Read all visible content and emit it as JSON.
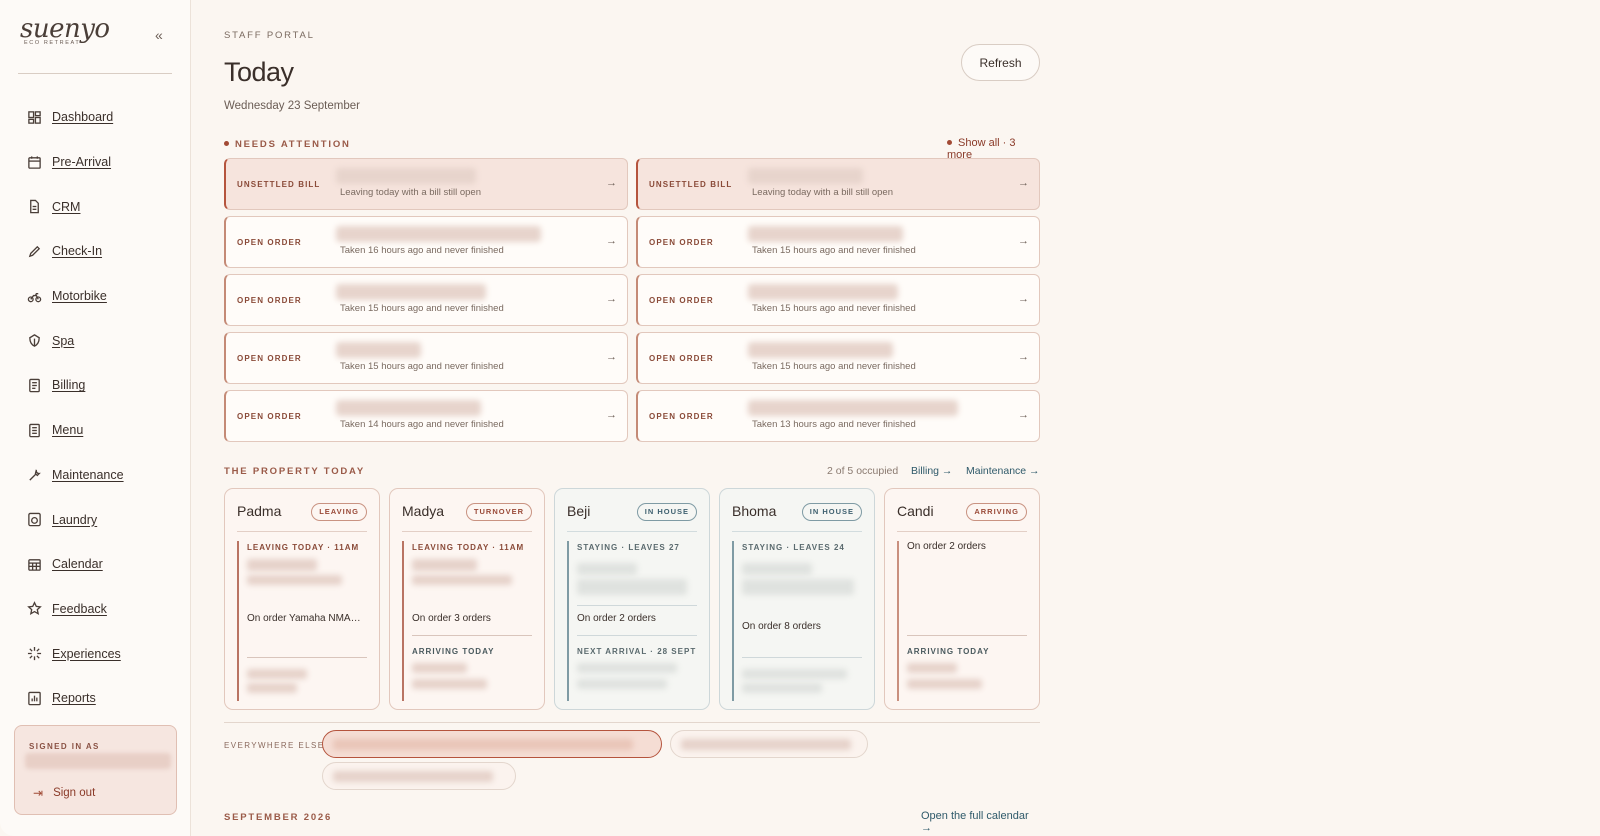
{
  "brand": {
    "wordmark": "suenyo",
    "tagline": "ECO RETREAT"
  },
  "sidebar": {
    "collapse_icon": "chevrons-left-icon",
    "items": [
      {
        "label": "Dashboard",
        "icon": "dashboard-icon"
      },
      {
        "label": "Pre-Arrival",
        "icon": "calendar-icon"
      },
      {
        "label": "CRM",
        "icon": "document-icon"
      },
      {
        "label": "Check-In",
        "icon": "pencil-icon"
      },
      {
        "label": "Motorbike",
        "icon": "motorbike-icon"
      },
      {
        "label": "Spa",
        "icon": "leaf-icon"
      },
      {
        "label": "Billing",
        "icon": "receipt-icon"
      },
      {
        "label": "Menu",
        "icon": "menu-icon"
      },
      {
        "label": "Maintenance",
        "icon": "wrench-icon"
      },
      {
        "label": "Laundry",
        "icon": "laundry-icon"
      },
      {
        "label": "Calendar",
        "icon": "calendar-grid-icon"
      },
      {
        "label": "Feedback",
        "icon": "star-icon"
      },
      {
        "label": "Experiences",
        "icon": "sparkle-icon"
      },
      {
        "label": "Reports",
        "icon": "chart-icon"
      }
    ],
    "signed_in_label": "SIGNED IN AS",
    "sign_out_label": "Sign out"
  },
  "header": {
    "eyebrow": "STAFF PORTAL",
    "title": "Today",
    "date": "Wednesday 23 September",
    "refresh_label": "Refresh"
  },
  "attention": {
    "label": "NEEDS ATTENTION",
    "show_all": "Show all · 3 more",
    "alerts": [
      {
        "type": "UNSETTLED BILL",
        "desc": "Leaving today with a bill still open",
        "kind": "urgent"
      },
      {
        "type": "UNSETTLED BILL",
        "desc": "Leaving today with a bill still open",
        "kind": "urgent"
      },
      {
        "type": "OPEN ORDER",
        "desc": "Taken 16 hours ago and never finished",
        "kind": "order"
      },
      {
        "type": "OPEN ORDER",
        "desc": "Taken 15 hours ago and never finished",
        "kind": "order"
      },
      {
        "type": "OPEN ORDER",
        "desc": "Taken 15 hours ago and never finished",
        "kind": "order"
      },
      {
        "type": "OPEN ORDER",
        "desc": "Taken 15 hours ago and never finished",
        "kind": "order"
      },
      {
        "type": "OPEN ORDER",
        "desc": "Taken 15 hours ago and never finished",
        "kind": "order"
      },
      {
        "type": "OPEN ORDER",
        "desc": "Taken 15 hours ago and never finished",
        "kind": "order"
      },
      {
        "type": "OPEN ORDER",
        "desc": "Taken 14 hours ago and never finished",
        "kind": "order"
      },
      {
        "type": "OPEN ORDER",
        "desc": "Taken 13 hours ago and never finished",
        "kind": "order"
      }
    ]
  },
  "property": {
    "label": "THE PROPERTY TODAY",
    "occupied": "2 of 5 occupied",
    "billing_link": "Billing →",
    "maintenance_link": "Maintenance →",
    "rooms": [
      {
        "name": "Padma",
        "badge": "LEAVING",
        "status": "LEAVING TODAY · 11AM",
        "order": "On order  Yamaha NMAX …",
        "arriving": ""
      },
      {
        "name": "Madya",
        "badge": "TURNOVER",
        "status": "LEAVING TODAY · 11AM",
        "order": "On order  3 orders",
        "arriving": "ARRIVING TODAY"
      },
      {
        "name": "Beji",
        "badge": "IN HOUSE",
        "status": "STAYING · LEAVES 27",
        "order": "On order  2 orders",
        "arriving": "NEXT ARRIVAL · 28 SEPT"
      },
      {
        "name": "Bhoma",
        "badge": "IN HOUSE",
        "status": "STAYING · LEAVES 24",
        "order": "On order  8 orders",
        "arriving": ""
      },
      {
        "name": "Candi",
        "badge": "ARRIVING",
        "status": "",
        "order": "On order  2 orders",
        "arriving": "ARRIVING TODAY"
      }
    ]
  },
  "everywhere": {
    "label": "EVERYWHERE ELSE"
  },
  "calendar": {
    "month": "SEPTEMBER 2026",
    "link": "Open the full calendar →"
  },
  "colors": {
    "accent": "#a24a35",
    "link": "#2f5a6a",
    "background": "#fbf6f1"
  }
}
